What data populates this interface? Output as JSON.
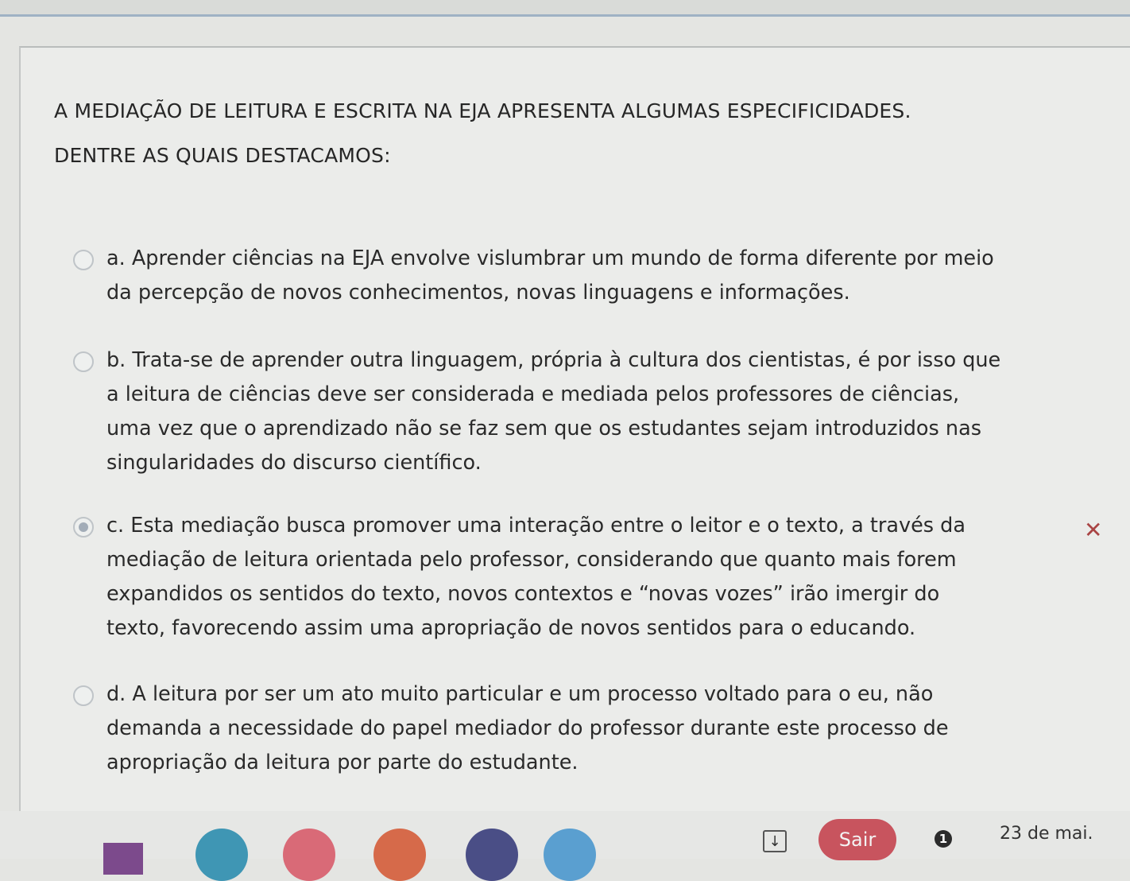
{
  "question": {
    "line1": "A MEDIAÇÃO DE LEITURA E ESCRITA NA EJA APRESENTA ALGUMAS ESPECIFICIDADES.",
    "line2": "DENTRE AS QUAIS DESTACAMOS:"
  },
  "options": [
    {
      "lines": [
        "a. Aprender ciências  na EJA envolve vislumbrar um mundo de forma diferente por meio",
        "da percepção de novos conhecimentos, novas linguagens e informações."
      ],
      "selected": false
    },
    {
      "lines": [
        "b. Trata-se de aprender outra linguagem, própria à cultura dos cientistas, é  por isso que",
        "a leitura de ciências deve ser considerada e mediada pelos professores de ciências,",
        "uma vez que o aprendizado não se faz sem que os estudantes sejam introduzidos nas",
        "singularidades do discurso científico."
      ],
      "selected": false
    },
    {
      "lines": [
        "c. Esta mediação busca promover uma interação entre o leitor e o texto, a través da",
        "mediação de leitura orientada pelo professor, considerando que quanto mais forem",
        "expandidos os sentidos do texto, novos contextos e “novas vozes” irão imergir do",
        "texto, favorecendo assim uma apropriação de novos sentidos para o educando."
      ],
      "selected": true,
      "feedback_icon": "x-icon"
    },
    {
      "lines": [
        "d. A leitura por ser um ato muito particular e um processo voltado para o eu, não",
        "demanda a necessidade do papel mediador do professor durante este processo de",
        "apropriação da leitura por parte do estudante."
      ],
      "selected": false
    }
  ],
  "feedback": {
    "wrong_icon": "✕",
    "wrong_color": "#a94444"
  },
  "taskbar": {
    "sair_label": "Sair",
    "info_badge": "1",
    "date": "23 de mai.",
    "download_icon": "↓",
    "sair_color": "#c8545e"
  }
}
